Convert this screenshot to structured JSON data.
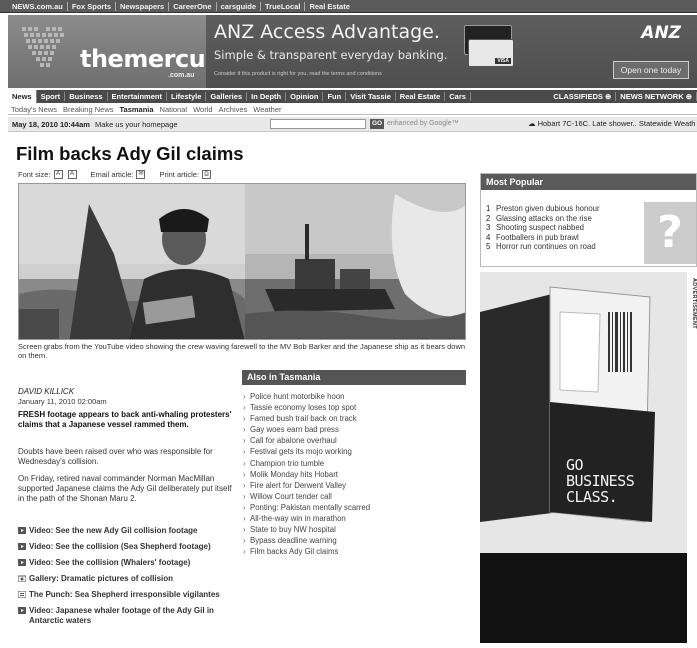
{
  "network_bar": [
    "NEWS.com.au",
    "Fox Sports",
    "Newspapers",
    "CareerOne",
    "carsguide",
    "TrueLocal",
    "Real Estate"
  ],
  "logo": {
    "main": "themercury",
    "sub": ".com.au"
  },
  "ad_banner": {
    "title": "ANZ Access Advantage.",
    "subtitle": "Simple & transparent everyday banking.",
    "fine_print": "Consider if this product is right for you, read the terms and conditions",
    "brand": "ANZ",
    "button": "Open one today",
    "card_brand": "VISA"
  },
  "nav": {
    "items": [
      "News",
      "Sport",
      "Business",
      "Entertainment",
      "Lifestyle",
      "Galleries",
      "In Depth",
      "Opinion",
      "Fun",
      "Visit Tassie",
      "Real Estate",
      "Cars"
    ],
    "classifieds": "CLASSIFIEDS ⊕",
    "network": "NEWS NETWORK ⊕"
  },
  "subnav": [
    "Today's News",
    "Breaking News",
    "Tasmania",
    "National",
    "World",
    "Archives",
    "Weather"
  ],
  "datebar": {
    "date": "May 18, 2010 10:44am",
    "homepage": "Make us your homepage",
    "go": "GO",
    "enhanced": "enhanced by Google™",
    "weather": "Hobart 7C-16C. Late shower.. Statewide Weath"
  },
  "article": {
    "title": "Film backs Ady Gil claims",
    "tools": {
      "font_size": "Font size:",
      "email": "Email article:",
      "print": "Print article:"
    },
    "caption": "Screen grabs from the YouTube video showing the crew waving farewell to the MV Bob Barker and the Japanese ship as it bears down on them.",
    "byline": "DAVID KILLICK",
    "pubdate": "January 11, 2010 02:00am",
    "lead": "FRESH footage appears to back anti-whaling protesters' claims that a Japanese vessel rammed them.",
    "p1": "Doubts have been raised over who was responsible for Wednesday's collision.",
    "p2": "On Friday, retired naval commander Norman MacMillan supported Japanese claims the Ady Gil deliberately put itself in the path of the Shonan Maru 2.",
    "links": [
      "Video: See the new Ady Gil collision footage",
      "Video: See the collision (Sea Shepherd footage)",
      "Video: See the collision (Whalers' footage)",
      "Gallery: Dramatic pictures of collision",
      "The Punch: Sea Shepherd irresponsible vigilantes",
      "Video: Japanese whaler footage of the Ady Gil in Antarctic waters"
    ]
  },
  "also": {
    "heading": "Also in Tasmania",
    "items": [
      "Police hunt motorbike hoon",
      "Tassie economy loses top spot",
      "Famed bush trail back on track",
      "Gay woes earn bad press",
      "Call for abalone overhaul",
      "Festival gets its mojo working",
      "Champion trio tumble",
      "Molik Monday hits Hobart",
      "Fire alert for Derwent Valley",
      "Willow Court tender call",
      "Ponting: Pakistan mentally scarred",
      "All-the-way win in marathon",
      "State to buy NW hospital",
      "Bypass deadline warning",
      "Film backs Ady Gil claims"
    ]
  },
  "popular": {
    "heading": "Most Popular",
    "items": [
      "Preston given dubious honour",
      "Glassing attacks on the rise",
      "Shooting suspect nabbed",
      "Footballers in pub brawl",
      "Horror run continues on road"
    ],
    "icon_glyph": "?"
  },
  "advert": {
    "label": "ADVERTISEMENT",
    "text": "GO BUSINESS CLASS."
  }
}
